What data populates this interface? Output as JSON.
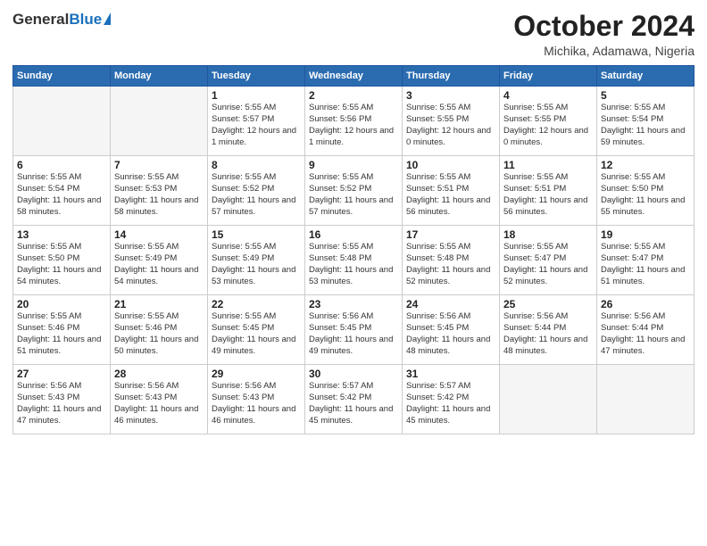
{
  "header": {
    "logo_general": "General",
    "logo_blue": "Blue",
    "month": "October 2024",
    "location": "Michika, Adamawa, Nigeria"
  },
  "days_of_week": [
    "Sunday",
    "Monday",
    "Tuesday",
    "Wednesday",
    "Thursday",
    "Friday",
    "Saturday"
  ],
  "weeks": [
    [
      {
        "day": "",
        "info": ""
      },
      {
        "day": "",
        "info": ""
      },
      {
        "day": "1",
        "info": "Sunrise: 5:55 AM\nSunset: 5:57 PM\nDaylight: 12 hours\nand 1 minute."
      },
      {
        "day": "2",
        "info": "Sunrise: 5:55 AM\nSunset: 5:56 PM\nDaylight: 12 hours\nand 1 minute."
      },
      {
        "day": "3",
        "info": "Sunrise: 5:55 AM\nSunset: 5:55 PM\nDaylight: 12 hours\nand 0 minutes."
      },
      {
        "day": "4",
        "info": "Sunrise: 5:55 AM\nSunset: 5:55 PM\nDaylight: 12 hours\nand 0 minutes."
      },
      {
        "day": "5",
        "info": "Sunrise: 5:55 AM\nSunset: 5:54 PM\nDaylight: 11 hours\nand 59 minutes."
      }
    ],
    [
      {
        "day": "6",
        "info": "Sunrise: 5:55 AM\nSunset: 5:54 PM\nDaylight: 11 hours\nand 58 minutes."
      },
      {
        "day": "7",
        "info": "Sunrise: 5:55 AM\nSunset: 5:53 PM\nDaylight: 11 hours\nand 58 minutes."
      },
      {
        "day": "8",
        "info": "Sunrise: 5:55 AM\nSunset: 5:52 PM\nDaylight: 11 hours\nand 57 minutes."
      },
      {
        "day": "9",
        "info": "Sunrise: 5:55 AM\nSunset: 5:52 PM\nDaylight: 11 hours\nand 57 minutes."
      },
      {
        "day": "10",
        "info": "Sunrise: 5:55 AM\nSunset: 5:51 PM\nDaylight: 11 hours\nand 56 minutes."
      },
      {
        "day": "11",
        "info": "Sunrise: 5:55 AM\nSunset: 5:51 PM\nDaylight: 11 hours\nand 56 minutes."
      },
      {
        "day": "12",
        "info": "Sunrise: 5:55 AM\nSunset: 5:50 PM\nDaylight: 11 hours\nand 55 minutes."
      }
    ],
    [
      {
        "day": "13",
        "info": "Sunrise: 5:55 AM\nSunset: 5:50 PM\nDaylight: 11 hours\nand 54 minutes."
      },
      {
        "day": "14",
        "info": "Sunrise: 5:55 AM\nSunset: 5:49 PM\nDaylight: 11 hours\nand 54 minutes."
      },
      {
        "day": "15",
        "info": "Sunrise: 5:55 AM\nSunset: 5:49 PM\nDaylight: 11 hours\nand 53 minutes."
      },
      {
        "day": "16",
        "info": "Sunrise: 5:55 AM\nSunset: 5:48 PM\nDaylight: 11 hours\nand 53 minutes."
      },
      {
        "day": "17",
        "info": "Sunrise: 5:55 AM\nSunset: 5:48 PM\nDaylight: 11 hours\nand 52 minutes."
      },
      {
        "day": "18",
        "info": "Sunrise: 5:55 AM\nSunset: 5:47 PM\nDaylight: 11 hours\nand 52 minutes."
      },
      {
        "day": "19",
        "info": "Sunrise: 5:55 AM\nSunset: 5:47 PM\nDaylight: 11 hours\nand 51 minutes."
      }
    ],
    [
      {
        "day": "20",
        "info": "Sunrise: 5:55 AM\nSunset: 5:46 PM\nDaylight: 11 hours\nand 51 minutes."
      },
      {
        "day": "21",
        "info": "Sunrise: 5:55 AM\nSunset: 5:46 PM\nDaylight: 11 hours\nand 50 minutes."
      },
      {
        "day": "22",
        "info": "Sunrise: 5:55 AM\nSunset: 5:45 PM\nDaylight: 11 hours\nand 49 minutes."
      },
      {
        "day": "23",
        "info": "Sunrise: 5:56 AM\nSunset: 5:45 PM\nDaylight: 11 hours\nand 49 minutes."
      },
      {
        "day": "24",
        "info": "Sunrise: 5:56 AM\nSunset: 5:45 PM\nDaylight: 11 hours\nand 48 minutes."
      },
      {
        "day": "25",
        "info": "Sunrise: 5:56 AM\nSunset: 5:44 PM\nDaylight: 11 hours\nand 48 minutes."
      },
      {
        "day": "26",
        "info": "Sunrise: 5:56 AM\nSunset: 5:44 PM\nDaylight: 11 hours\nand 47 minutes."
      }
    ],
    [
      {
        "day": "27",
        "info": "Sunrise: 5:56 AM\nSunset: 5:43 PM\nDaylight: 11 hours\nand 47 minutes."
      },
      {
        "day": "28",
        "info": "Sunrise: 5:56 AM\nSunset: 5:43 PM\nDaylight: 11 hours\nand 46 minutes."
      },
      {
        "day": "29",
        "info": "Sunrise: 5:56 AM\nSunset: 5:43 PM\nDaylight: 11 hours\nand 46 minutes."
      },
      {
        "day": "30",
        "info": "Sunrise: 5:57 AM\nSunset: 5:42 PM\nDaylight: 11 hours\nand 45 minutes."
      },
      {
        "day": "31",
        "info": "Sunrise: 5:57 AM\nSunset: 5:42 PM\nDaylight: 11 hours\nand 45 minutes."
      },
      {
        "day": "",
        "info": ""
      },
      {
        "day": "",
        "info": ""
      }
    ]
  ]
}
